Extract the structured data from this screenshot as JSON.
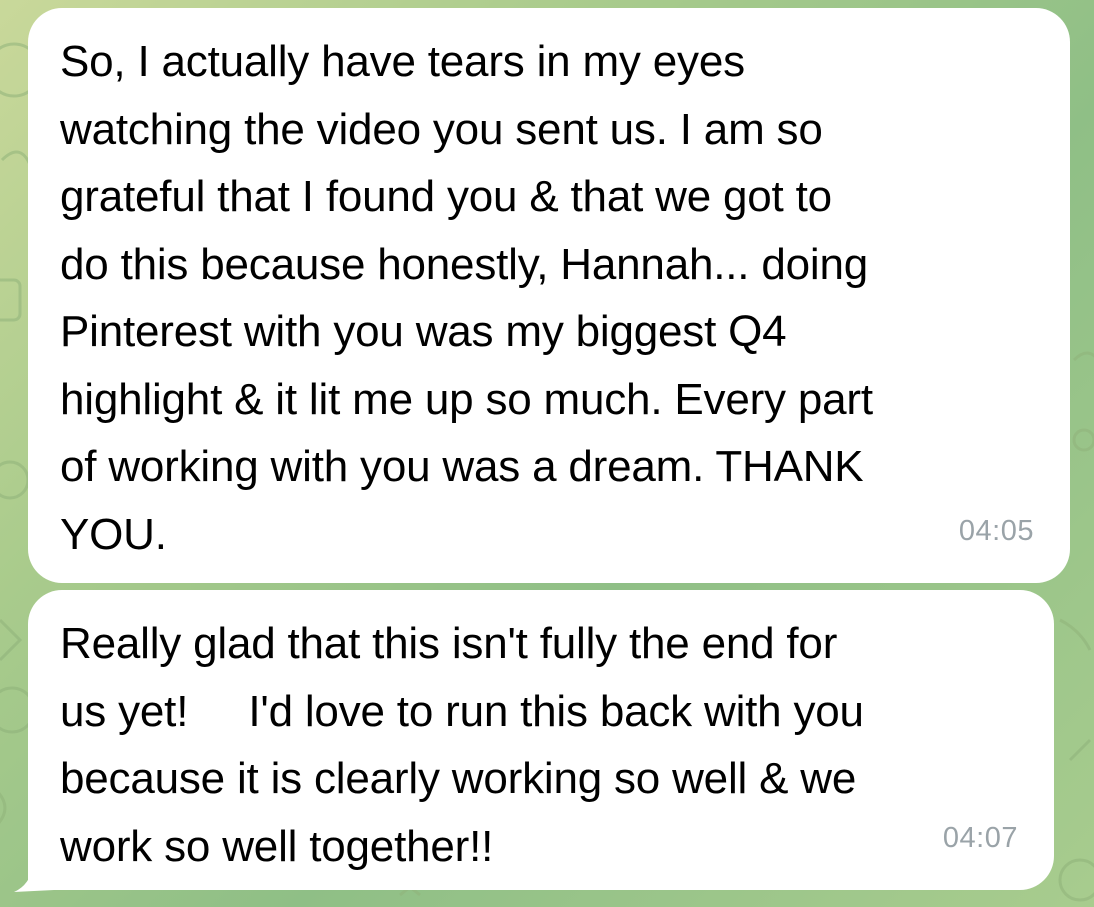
{
  "chat": {
    "messages": [
      {
        "text": "So, I actually have tears in my eyes\nwatching the video you sent us. I am so\ngrateful that I found you & that we got to\ndo this because honestly, Hannah... doing\nPinterest with you was my biggest Q4\nhighlight & it lit me up so much. Every part\nof working with you was a dream. THANK\nYOU.",
        "time": "04:05"
      },
      {
        "text": "Really glad that this isn't fully the end for\nus yet!     I'd love to run this back with you\nbecause it is clearly working so well & we\nwork so well together!!",
        "time": "04:07"
      }
    ]
  },
  "colors": {
    "bubble_background": "#ffffff",
    "chat_wallpaper": "#9fc68b",
    "timestamp": "#9aa3a8"
  },
  "icons": [
    "bubble-tail-icon"
  ]
}
